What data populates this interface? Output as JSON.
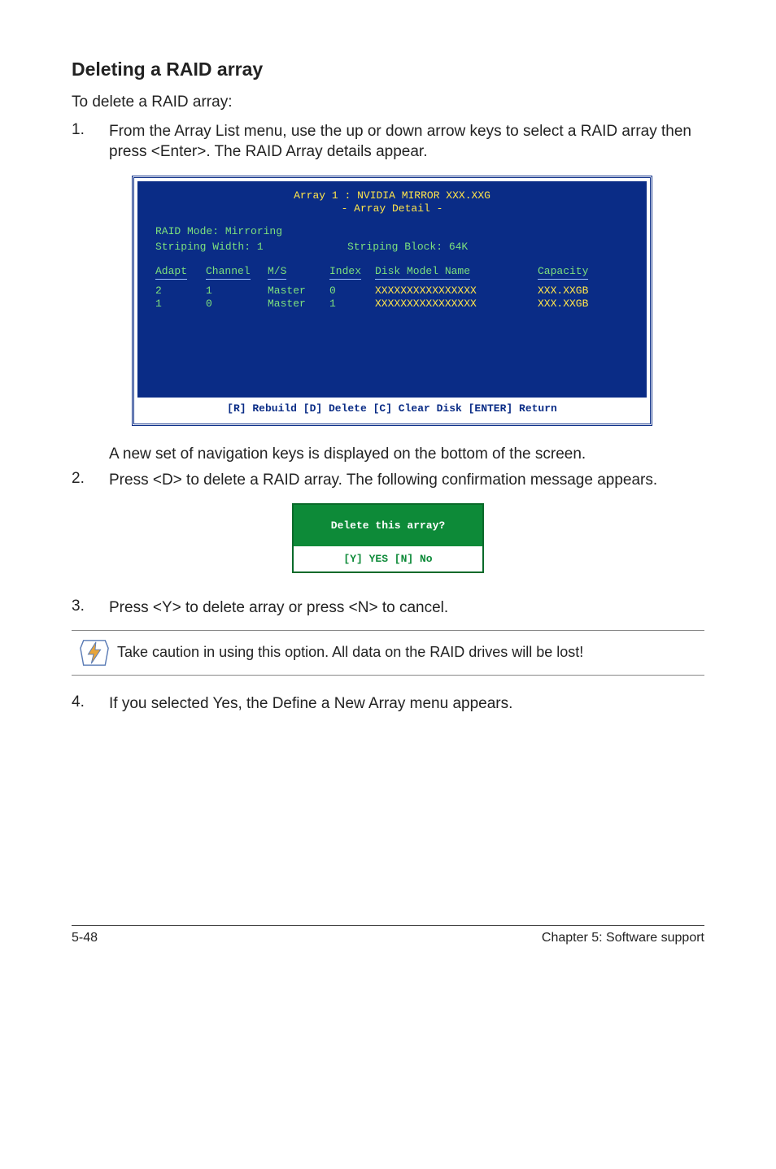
{
  "heading": "Deleting a RAID array",
  "intro": "To delete a RAID array:",
  "step1": "From the Array List menu, use the up or down arrow keys to select a RAID array then press <Enter>. The RAID Array details appear.",
  "bios": {
    "title_line1": "Array 1 : NVIDIA MIRROR  XXX.XXG",
    "title_line2": "- Array Detail -",
    "raid_mode_label": "RAID Mode: Mirroring",
    "striping_width_label": "Striping Width: 1",
    "striping_block_label": "Striping Block: 64K",
    "headers": {
      "adapt": "Adapt",
      "channel": "Channel",
      "ms": "M/S",
      "index": "Index",
      "model": "Disk Model Name",
      "capacity": "Capacity"
    },
    "rows": [
      {
        "adapt": "2",
        "channel": "1",
        "ms": "Master",
        "index": "0",
        "model": "XXXXXXXXXXXXXXXX",
        "capacity": "XXX.XXGB"
      },
      {
        "adapt": "1",
        "channel": "0",
        "ms": "Master",
        "index": "1",
        "model": "XXXXXXXXXXXXXXXX",
        "capacity": "XXX.XXGB"
      }
    ],
    "footer": "[R] Rebuild  [D] Delete  [C] Clear Disk  [ENTER] Return"
  },
  "after_bios": "A new set of  navigation keys is displayed on the bottom of the screen.",
  "step2": "Press <D> to delete a RAID array. The following confirmation message appears.",
  "dialog": {
    "question": "Delete this array?",
    "options": "[Y] YES   [N] No"
  },
  "step3": "Press <Y> to delete array or press <N> to cancel.",
  "caution": "Take caution in using this option. All data on the RAID drives will be lost!",
  "step4": "If you selected Yes, the Define a New Array menu appears.",
  "footer_left": "5-48",
  "footer_right": "Chapter 5: Software support",
  "nums": {
    "n1": "1.",
    "n2": "2.",
    "n3": "3.",
    "n4": "4."
  }
}
